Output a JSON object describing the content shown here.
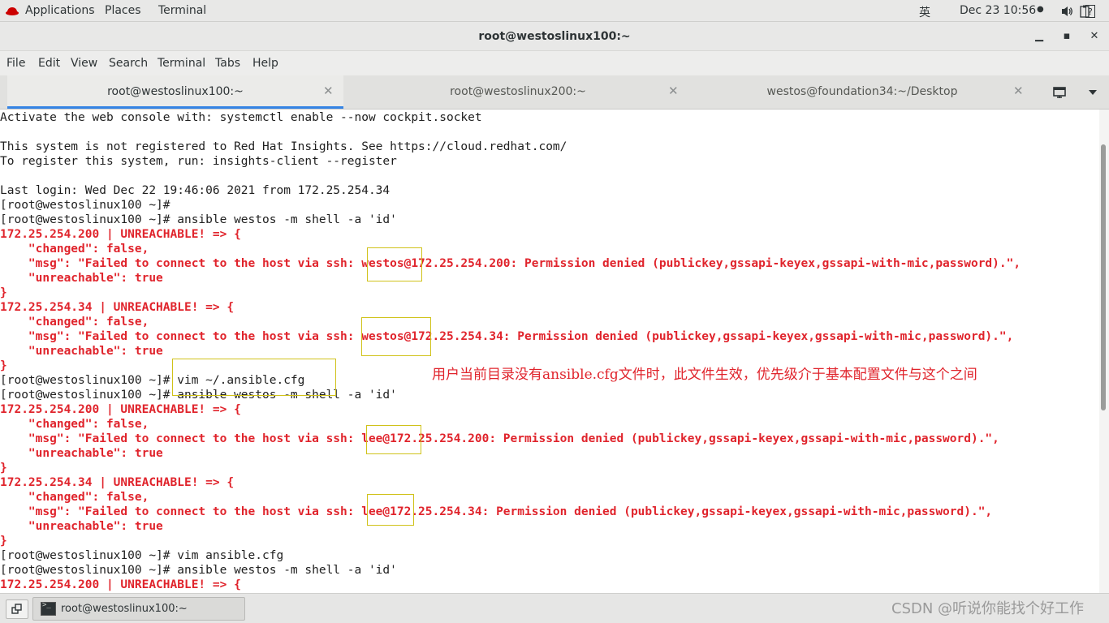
{
  "topbar": {
    "applications": "Applications",
    "places": "Places",
    "terminal": "Terminal",
    "input_method": "英",
    "clock": "Dec 23  10:56",
    "record_indicator": "●"
  },
  "window": {
    "title": "root@westoslinux100:~",
    "minimize": "▁",
    "maximize": "▪",
    "close": "✕"
  },
  "menu": [
    "File",
    "Edit",
    "View",
    "Search",
    "Terminal",
    "Tabs",
    "Help"
  ],
  "tabs": [
    {
      "label": "root@westoslinux100:~",
      "active": true
    },
    {
      "label": "root@westoslinux200:~",
      "active": false
    },
    {
      "label": "westos@foundation34:~/Desktop",
      "active": false
    }
  ],
  "terminal_lines": [
    {
      "text": "Activate the web console with: systemctl enable --now cockpit.socket",
      "style": "normal"
    },
    {
      "text": "",
      "style": "normal"
    },
    {
      "text": "This system is not registered to Red Hat Insights. See https://cloud.redhat.com/",
      "style": "normal"
    },
    {
      "text": "To register this system, run: insights-client --register",
      "style": "normal"
    },
    {
      "text": "",
      "style": "normal"
    },
    {
      "text": "Last login: Wed Dec 22 19:46:06 2021 from 172.25.254.34",
      "style": "normal"
    },
    {
      "text": "[root@westoslinux100 ~]#",
      "style": "normal"
    },
    {
      "text": "[root@westoslinux100 ~]# ansible westos -m shell -a 'id'",
      "style": "normal"
    },
    {
      "text": "172.25.254.200 | UNREACHABLE! => {",
      "style": "err"
    },
    {
      "text": "    \"changed\": false,",
      "style": "err"
    },
    {
      "text": "    \"msg\": \"Failed to connect to the host via ssh: westos@172.25.254.200: Permission denied (publickey,gssapi-keyex,gssapi-with-mic,password).\",",
      "style": "err"
    },
    {
      "text": "    \"unreachable\": true",
      "style": "err"
    },
    {
      "text": "}",
      "style": "err"
    },
    {
      "text": "172.25.254.34 | UNREACHABLE! => {",
      "style": "err"
    },
    {
      "text": "    \"changed\": false,",
      "style": "err"
    },
    {
      "text": "    \"msg\": \"Failed to connect to the host via ssh: westos@172.25.254.34: Permission denied (publickey,gssapi-keyex,gssapi-with-mic,password).\",",
      "style": "err"
    },
    {
      "text": "    \"unreachable\": true",
      "style": "err"
    },
    {
      "text": "}",
      "style": "err"
    },
    {
      "text": "[root@westoslinux100 ~]# vim ~/.ansible.cfg",
      "style": "normal"
    },
    {
      "text": "[root@westoslinux100 ~]# ansible westos -m shell -a 'id'",
      "style": "normal"
    },
    {
      "text": "172.25.254.200 | UNREACHABLE! => {",
      "style": "err"
    },
    {
      "text": "    \"changed\": false,",
      "style": "err"
    },
    {
      "text": "    \"msg\": \"Failed to connect to the host via ssh: lee@172.25.254.200: Permission denied (publickey,gssapi-keyex,gssapi-with-mic,password).\",",
      "style": "err"
    },
    {
      "text": "    \"unreachable\": true",
      "style": "err"
    },
    {
      "text": "}",
      "style": "err"
    },
    {
      "text": "172.25.254.34 | UNREACHABLE! => {",
      "style": "err"
    },
    {
      "text": "    \"changed\": false,",
      "style": "err"
    },
    {
      "text": "    \"msg\": \"Failed to connect to the host via ssh: lee@172.25.254.34: Permission denied (publickey,gssapi-keyex,gssapi-with-mic,password).\",",
      "style": "err"
    },
    {
      "text": "    \"unreachable\": true",
      "style": "err"
    },
    {
      "text": "}",
      "style": "err"
    },
    {
      "text": "[root@westoslinux100 ~]# vim ansible.cfg",
      "style": "normal"
    },
    {
      "text": "[root@westoslinux100 ~]# ansible westos -m shell -a 'id'",
      "style": "normal"
    },
    {
      "text": "172.25.254.200 | UNREACHABLE! => {",
      "style": "err"
    }
  ],
  "annotation": {
    "text": "用户当前目录没有ansible.cfg文件时，此文件生效，优先级介于基本配置文件与这个之间",
    "highlight_color": "#d0c21a"
  },
  "taskbar": {
    "window_label": "root@westoslinux100:~"
  },
  "watermark": "CSDN @听说你能找个好工作",
  "colors": {
    "error_text": "#e0242c",
    "accent_tab": "#3584e4"
  }
}
